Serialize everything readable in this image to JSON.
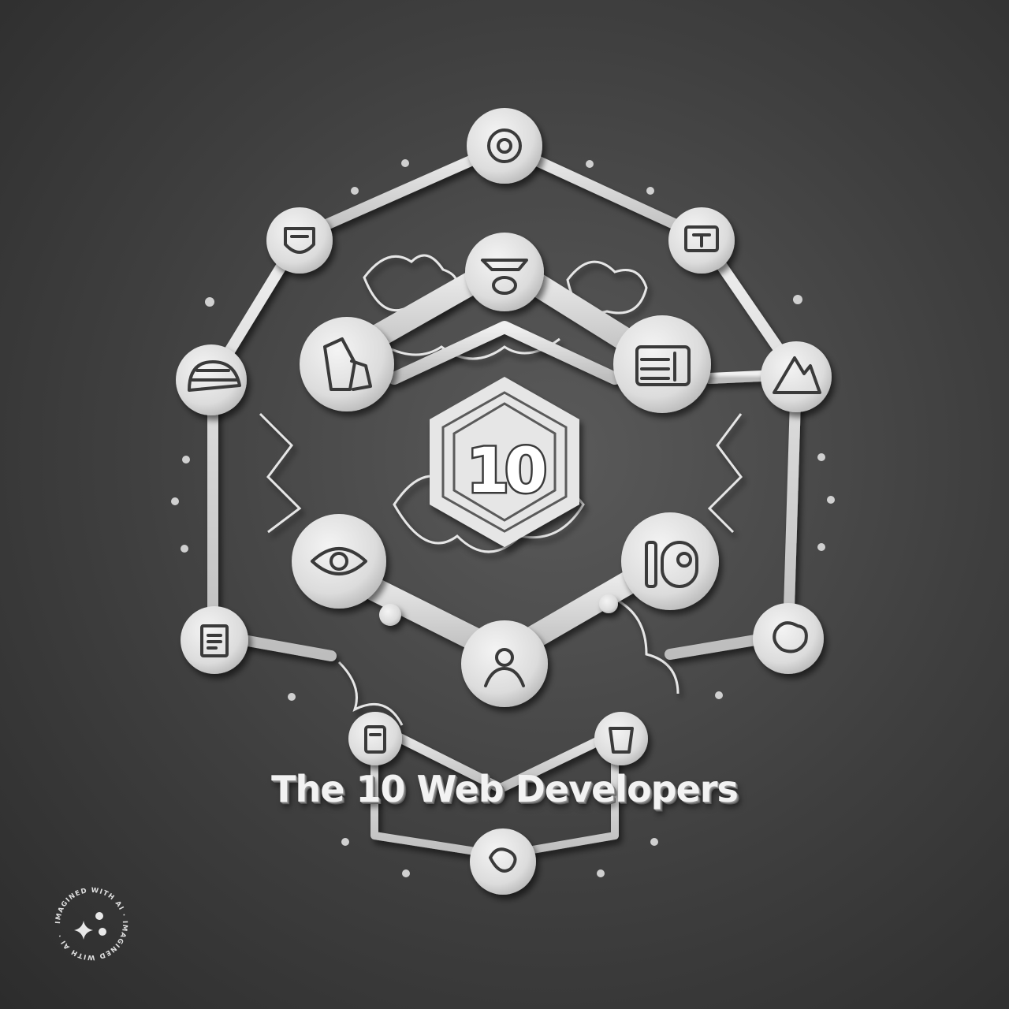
{
  "logo": {
    "center_number": "10",
    "right_node_number": "10",
    "title_parts": [
      "The 10",
      "Web",
      "Developers"
    ]
  },
  "watermark": {
    "ring_text": "IMAGINED WITH AI · IMAGINED WITH AI · "
  },
  "colors": {
    "background": "#444444",
    "relief": "#e8e8e8",
    "relief_shadow": "#8a8a8a",
    "text": "#f2f2f2"
  },
  "icons": [
    "gear-icon",
    "shield-icon",
    "monitor-icon",
    "camera-icon",
    "helmet-icon",
    "rock-icon",
    "browser-window-icon",
    "tent-icon",
    "eye-icon",
    "toggle-switch-icon",
    "document-icon",
    "user-icon",
    "cloud-icon",
    "device-icon",
    "cup-icon",
    "link-icon"
  ]
}
